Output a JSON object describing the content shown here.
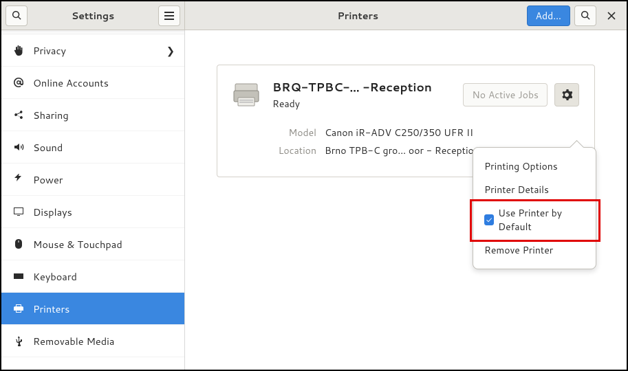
{
  "header": {
    "left_title": "Settings",
    "right_title": "Printers",
    "add_label": "Add…"
  },
  "sidebar": {
    "items": [
      {
        "icon": "hand",
        "label": "Privacy",
        "chevron": true
      },
      {
        "icon": "at",
        "label": "Online Accounts",
        "chevron": false
      },
      {
        "icon": "share",
        "label": "Sharing",
        "chevron": false
      },
      {
        "icon": "sound",
        "label": "Sound",
        "chevron": false
      },
      {
        "icon": "power",
        "label": "Power",
        "chevron": false
      },
      {
        "icon": "display",
        "label": "Displays",
        "chevron": false
      },
      {
        "icon": "mouse",
        "label": "Mouse & Touchpad",
        "chevron": false
      },
      {
        "icon": "keyboard",
        "label": "Keyboard",
        "chevron": false
      },
      {
        "icon": "printer",
        "label": "Printers",
        "chevron": false,
        "selected": true
      },
      {
        "icon": "usb",
        "label": "Removable Media",
        "chevron": false
      }
    ]
  },
  "printer": {
    "name": "BRQ-TPBC-…  -Reception",
    "status": "Ready",
    "jobs_button": "No Active Jobs",
    "model_label": "Model",
    "model_value": "Canon iR-ADV C250/350 UFR II",
    "location_label": "Location",
    "location_value": "Brno TPB-C gro… oor - Reception"
  },
  "popover": {
    "items": [
      {
        "label": "Printing Options",
        "check": false
      },
      {
        "label": "Printer Details",
        "check": false
      },
      {
        "label": "Use Printer by Default",
        "check": true,
        "checked": true,
        "highlight": true
      },
      {
        "label": "Remove Printer",
        "check": false
      }
    ]
  }
}
